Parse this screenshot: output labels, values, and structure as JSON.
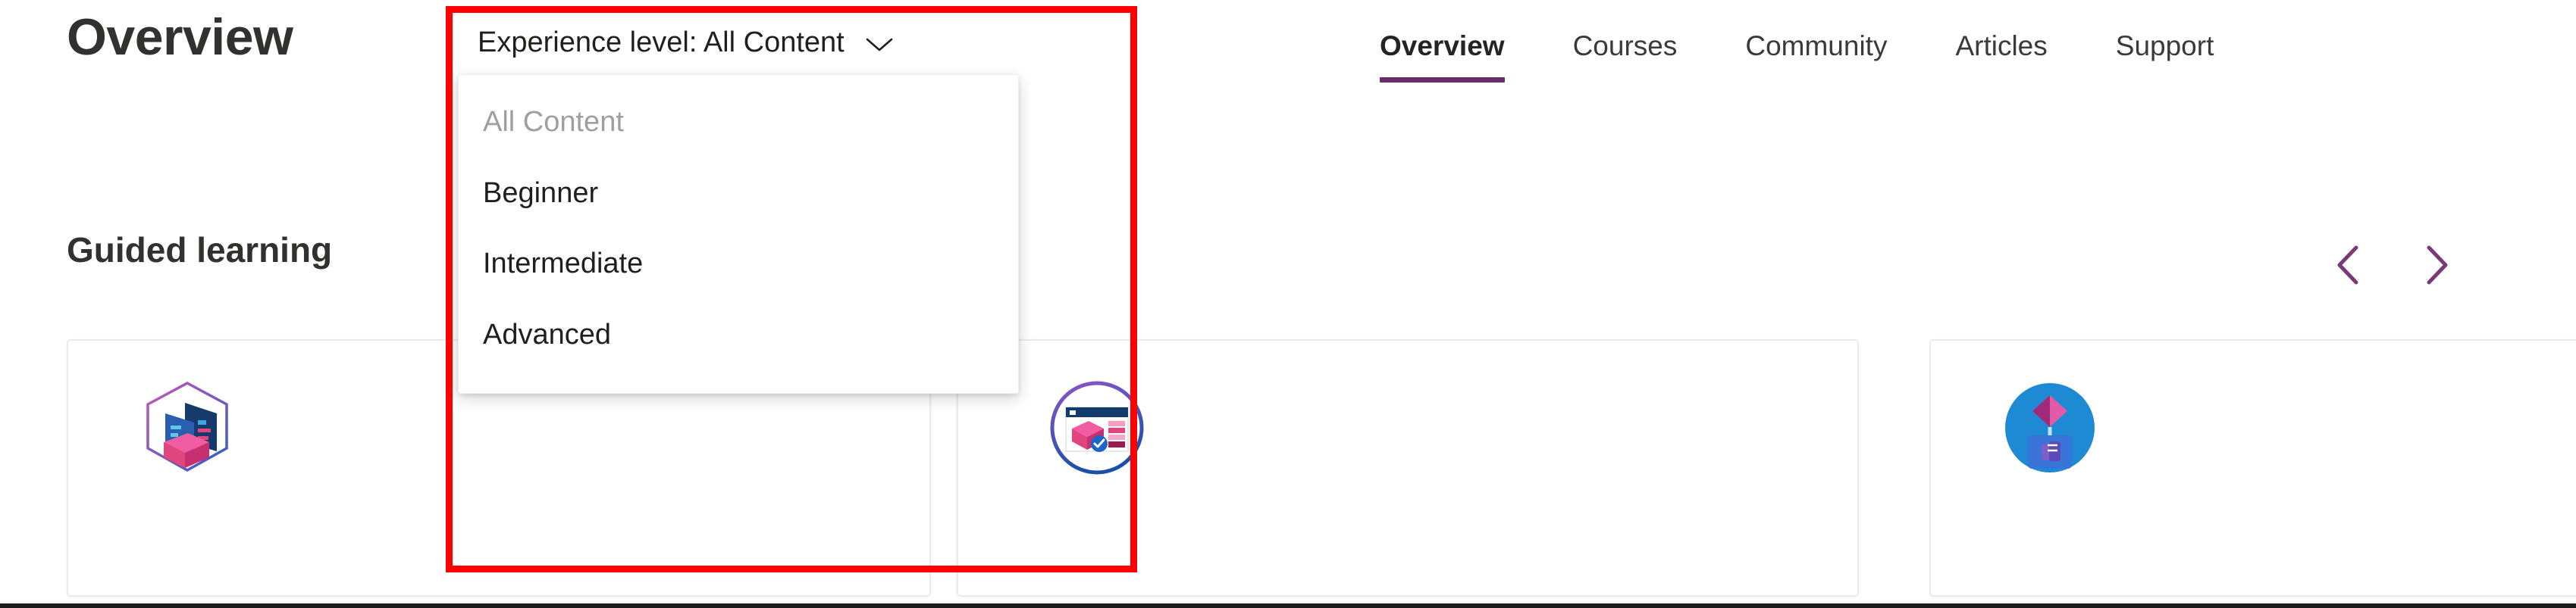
{
  "page": {
    "title": "Overview",
    "section_title": "Guided learning"
  },
  "top_nav": {
    "items": [
      {
        "label": "Overview",
        "active": true
      },
      {
        "label": "Courses",
        "active": false
      },
      {
        "label": "Community",
        "active": false
      },
      {
        "label": "Articles",
        "active": false
      },
      {
        "label": "Support",
        "active": false
      }
    ],
    "active_underline_color": "#6b2c6b"
  },
  "experience_filter": {
    "trigger_label": "Experience level: All Content",
    "chevron_icon": "chevron-down-icon",
    "expanded": true,
    "options": [
      {
        "label": "All Content",
        "selected": true
      },
      {
        "label": "Beginner",
        "selected": false
      },
      {
        "label": "Intermediate",
        "selected": false
      },
      {
        "label": "Advanced",
        "selected": false
      }
    ]
  },
  "carousel": {
    "previous_icon": "chevron-left-icon",
    "next_icon": "chevron-right-icon",
    "arrow_color": "#7a3a78"
  },
  "cards": [
    {
      "icon": "hexagon-data-badge-icon"
    },
    {
      "icon": "circle-browser-cube-badge-icon"
    },
    {
      "icon": "circle-teams-power-platform-icon"
    }
  ],
  "annotation": {
    "shape": "rectangle",
    "color": "#ff0000",
    "target": "experience-level-dropdown"
  }
}
